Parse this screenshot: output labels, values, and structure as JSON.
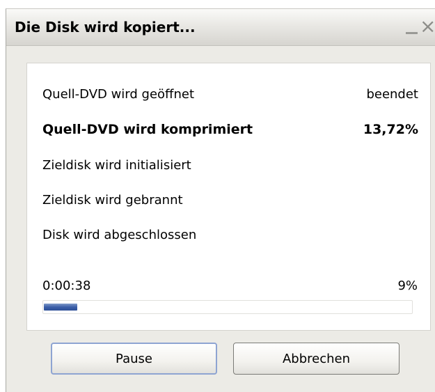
{
  "window": {
    "title": "Die Disk wird kopiert...",
    "close_glyph": "×"
  },
  "steps": [
    {
      "label": "Quell-DVD wird geöffnet",
      "status": "beendet"
    },
    {
      "label": "Quell-DVD wird komprimiert",
      "status": "13,72%",
      "active": true
    },
    {
      "label": "Zieldisk wird initialisiert",
      "status": ""
    },
    {
      "label": "Zieldisk wird gebrannt",
      "status": ""
    },
    {
      "label": "Disk wird abgeschlossen",
      "status": ""
    }
  ],
  "progress": {
    "elapsed": "0:00:38",
    "percent_label": "9%",
    "fraction": 0.09,
    "fill_color": "#3b5ea8"
  },
  "buttons": {
    "pause_label": "Pause",
    "cancel_label": "Abbrechen"
  }
}
